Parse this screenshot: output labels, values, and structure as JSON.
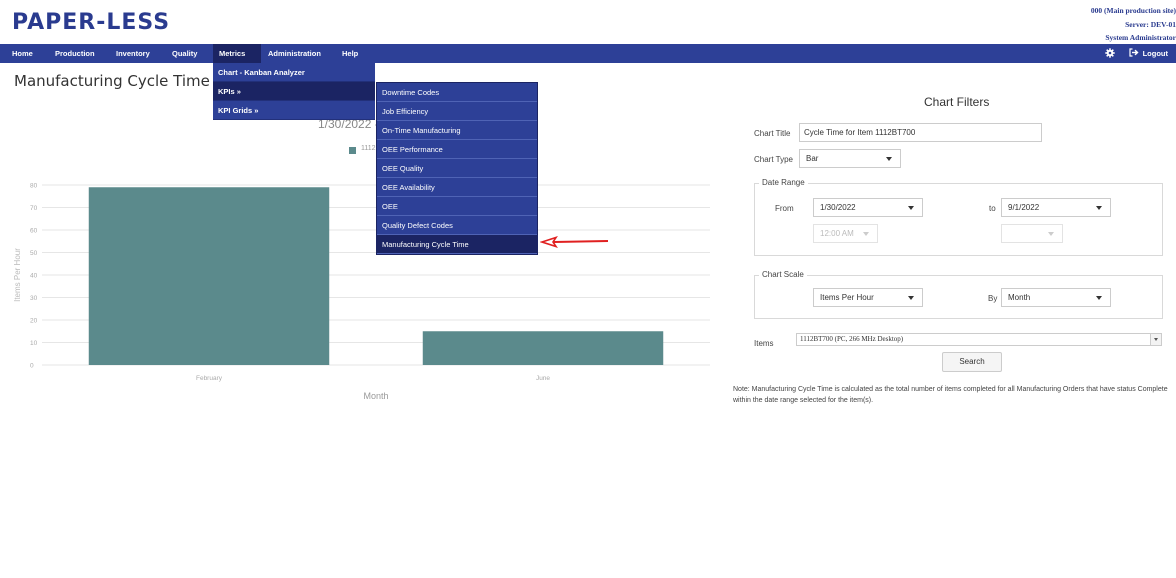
{
  "app": {
    "logo": "PAPER-LESS",
    "site": "000 (Main production site)",
    "server": "Server: DEV-01",
    "user": "System Administrator"
  },
  "nav": {
    "items": [
      "Home",
      "Production",
      "Inventory",
      "Quality",
      "Metrics",
      "Administration",
      "Help"
    ],
    "active": "Metrics",
    "logout": "Logout",
    "settings_icon": "gear-icon",
    "logout_icon": "sign-out-icon"
  },
  "page": {
    "title": "Manufacturing Cycle Time"
  },
  "menus": {
    "metrics": [
      "Chart - Kanban Analyzer",
      "KPIs »",
      "KPI Grids »"
    ],
    "kpis": [
      "Downtime Codes",
      "Job Efficiency",
      "On-Time Manufacturing",
      "OEE Performance",
      "OEE Quality",
      "OEE Availability",
      "OEE",
      "Quality Defect Codes",
      "Manufacturing Cycle Time"
    ],
    "selected_kpi": "Manufacturing Cycle Time"
  },
  "chart_data": {
    "type": "bar",
    "title_visible_fragment": "1/30/2022 -",
    "legend_fragment": "1112",
    "categories": [
      "February",
      "June"
    ],
    "values": [
      79,
      15
    ],
    "xlabel": "Month",
    "ylabel": "Items Per Hour",
    "ylim": [
      0,
      80
    ],
    "yticks": [
      0,
      10,
      20,
      30,
      40,
      50,
      60,
      70,
      80
    ],
    "bar_color": "#5b8a8c",
    "grid": true
  },
  "filters": {
    "heading": "Chart Filters",
    "chart_title_label": "Chart Title",
    "chart_title_value": "Cycle Time for Item 1112BT700",
    "chart_type_label": "Chart Type",
    "chart_type_value": "Bar",
    "date_range_label": "Date Range",
    "from_label": "From",
    "from_date": "1/30/2022",
    "from_time": "12:00 AM",
    "to_label": "to",
    "to_date": "9/1/2022",
    "to_time": "",
    "chart_scale_label": "Chart Scale",
    "scale_value": "Items Per Hour",
    "by_label": "By",
    "by_value": "Month",
    "items_label": "Items",
    "items_value": "1112BT700 (PC, 266 MHz Desktop)",
    "search_label": "Search",
    "note": "Note: Manufacturing Cycle Time is calculated as the total number of items completed for all Manufacturing Orders that have status Complete within the date range selected for the item(s)."
  }
}
